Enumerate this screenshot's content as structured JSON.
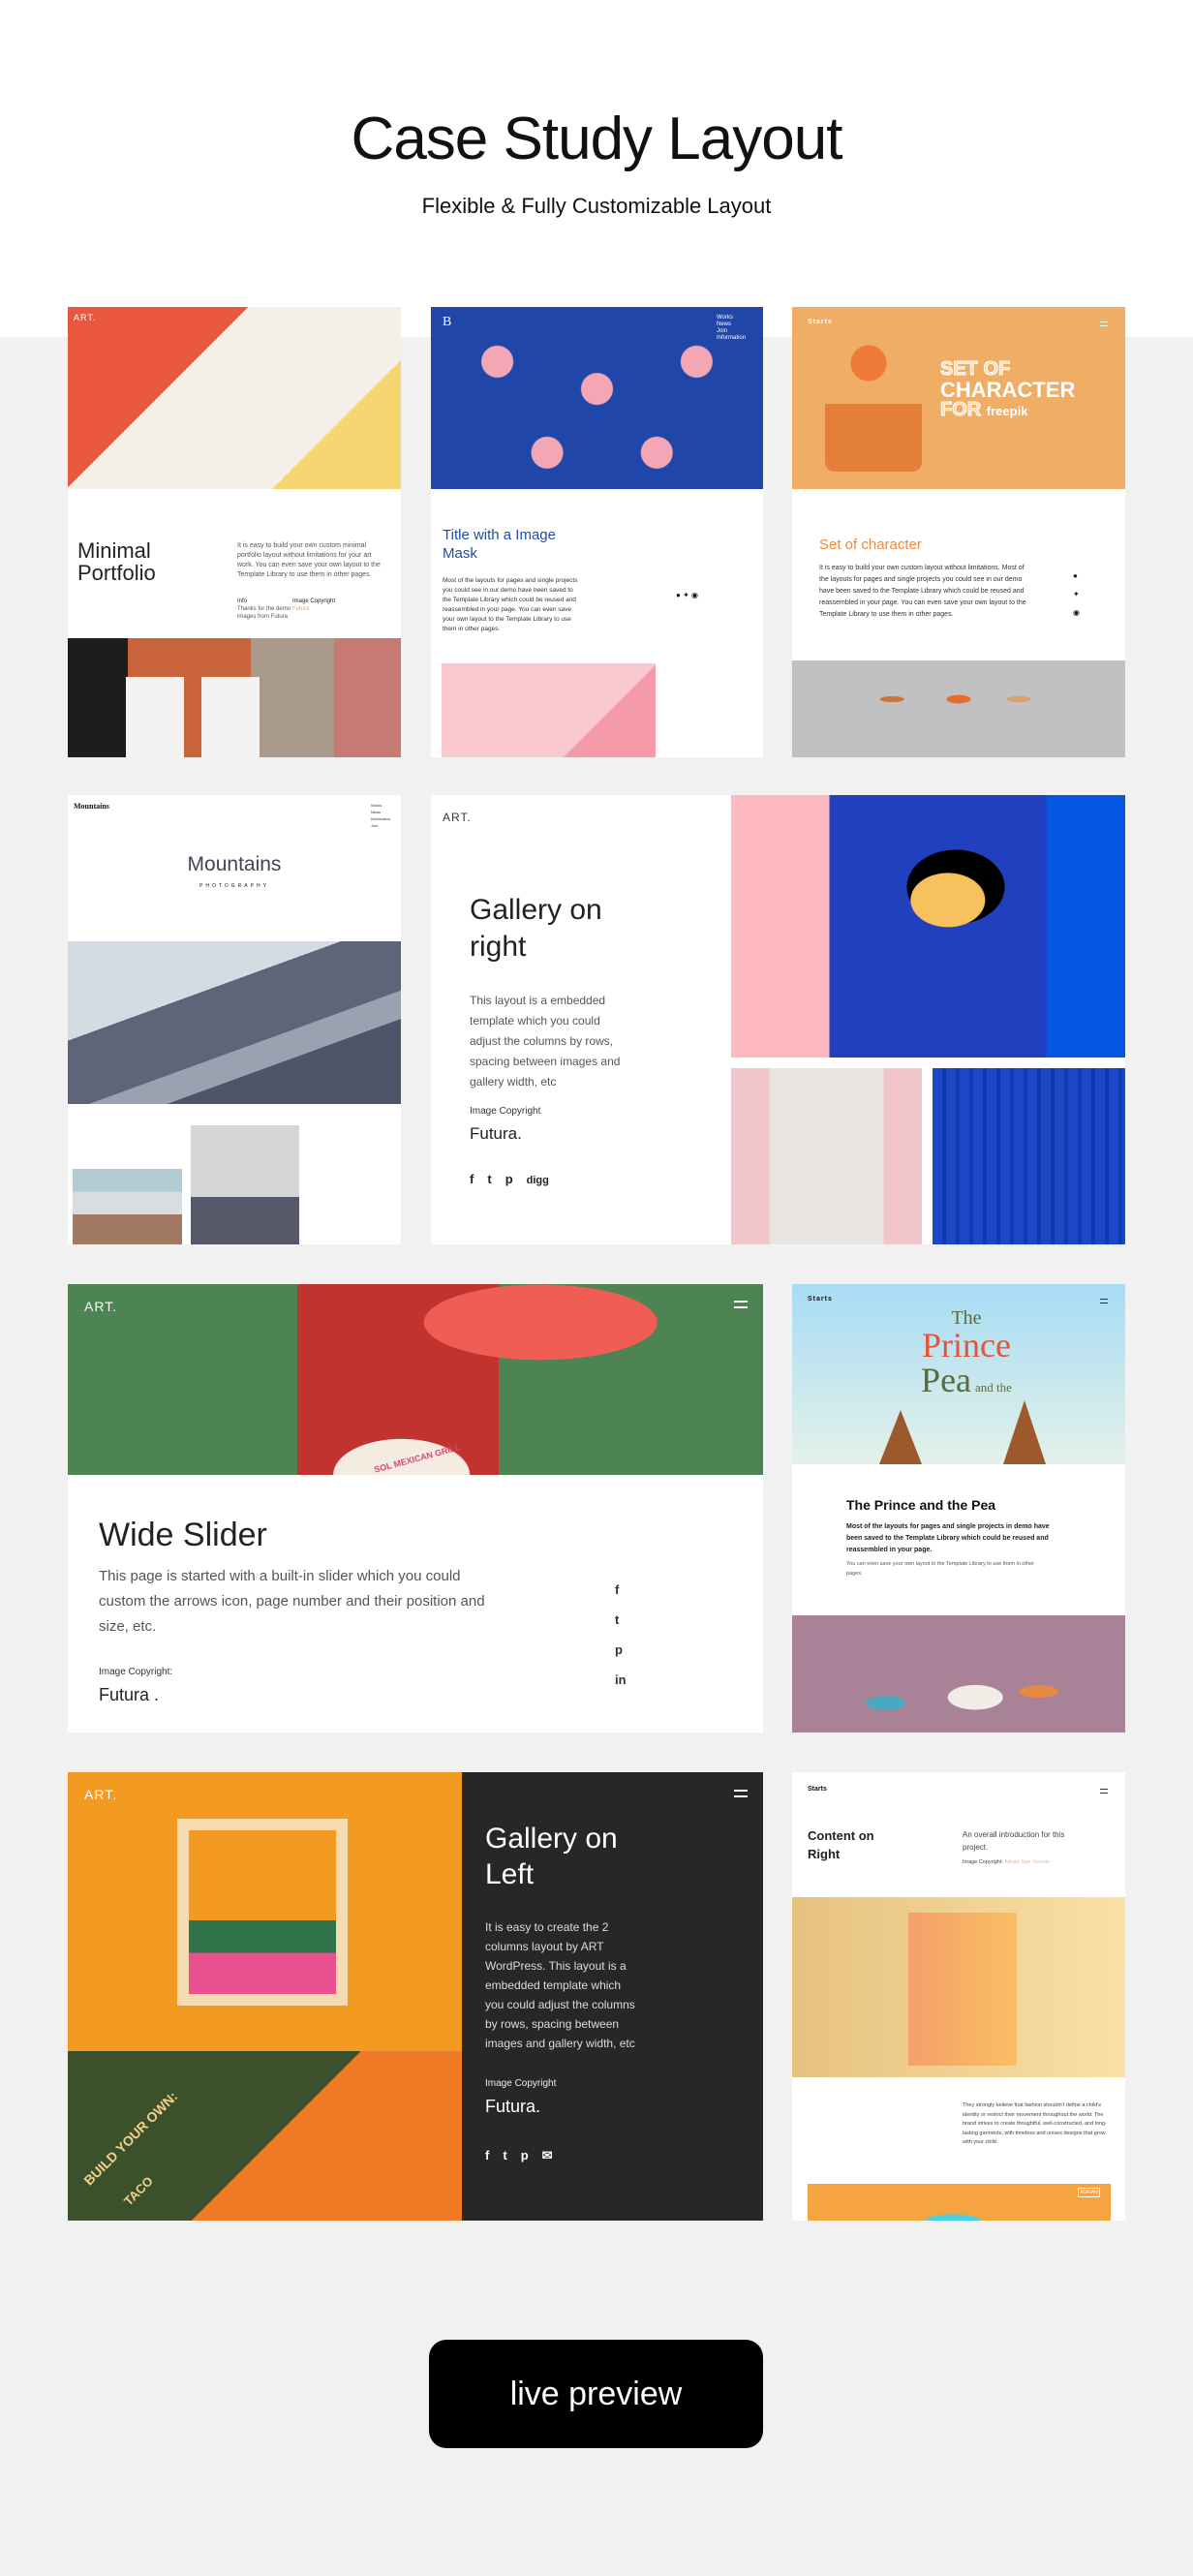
{
  "header": {
    "title": "Case Study Layout",
    "subtitle": "Flexible & Fully Customizable Layout"
  },
  "cards": {
    "minimal": {
      "logo": "ART.",
      "title_1": "Minimal",
      "title_2": "Portfolio",
      "body": "It is easy to build your own custom minimal portfolio layout without limitations for your art work. You can even save your own layout to the Template Library to use them in other pages.",
      "info_label": "Info",
      "info_text": "Thanks for the demo images from Futura",
      "copyright_label": "Image Copyright",
      "copyright_value": "Futura"
    },
    "mask": {
      "logo": "B",
      "nav": [
        "Works",
        "News",
        "Join",
        "Information"
      ],
      "title": "Title with a Image Mask",
      "body": "Most of the layouts for pages and single projects you could see in our demo have been saved to the Template Library which could be reused and reassembled in your page. You can even save your own layout to the Template Library to use them in other pages."
    },
    "character": {
      "logo": "Starts",
      "hero_1": "SET OF",
      "hero_2": "CHARACTER",
      "hero_3": "FOR",
      "hero_brand": "freepik",
      "title": "Set of character",
      "body": "It is easy to build your own custom layout without limitations. Most of the layouts for pages and single projects you could see in our demo have been saved to the Template Library which could be reused and reassembled in your page. You can even save your own layout to the Template Library to use them in other pages."
    },
    "mountains": {
      "logo": "Mountains",
      "nav": [
        "Works",
        "News",
        "Information",
        "Join"
      ],
      "title": "Mountains",
      "subtitle": "PHOTOGRAPHY"
    },
    "gallery_right": {
      "logo": "ART.",
      "title_1": "Gallery on",
      "title_2": "right",
      "body": "This layout is a embedded template which you could adjust the columns by rows, spacing between images and gallery width, etc",
      "copyright_label": "Image Copyright",
      "copyright_value": "Futura.",
      "digg": "digg"
    },
    "wide_slider": {
      "logo": "ART.",
      "label": "SOL MEXICAN GRILL",
      "title": "Wide Slider",
      "body": "This page is started with a built-in slider which you could custom the arrows icon, page number and their position and size, etc.",
      "copyright_label": "Image Copyright:",
      "copyright_value": "Futura ."
    },
    "prince": {
      "logo": "Starts",
      "hero_1": "The",
      "hero_2": "Prince",
      "hero_3": "and the",
      "hero_4": "Pea",
      "title": "The Prince and the Pea",
      "body_bold": "Most of the layouts for pages and single projects in demo have been saved to the Template Library which could be reused and reassembled in your page.",
      "body": "You can even save your own layout to the Template Library to use them in other pages."
    },
    "gallery_left": {
      "logo": "ART.",
      "title_1": "Gallery on",
      "title_2": "Left",
      "body": "It is easy to create the 2 columns layout by ART WordPress. This layout is a embedded template which you could adjust the columns by rows, spacing between images and gallery width, etc",
      "copyright_label": "Image Copyright",
      "copyright_value": "Futura.",
      "poster_text": "BUILD YOUR OWN:",
      "poster_text_2": "TACO"
    },
    "content_right": {
      "logo": "Starts",
      "title_1": "Content on",
      "title_2": "Right",
      "intro": "An overall introduction for this project.",
      "copyright_label": "Image Copyright:",
      "copyright_value": "Adrián San Vicente",
      "body": "They strongly believe that fashion shouldn't define a child's identity or restrict their movement throughout the world. The brand strives to create thoughtful, well-constructed, and long-lasting garments, with timeless and unisex designs that grow with your child.",
      "badge": "ADRIÁN"
    }
  },
  "cta": {
    "label": "live preview"
  },
  "colors": {
    "accent_orange": "#f0ad66",
    "dark_panel": "#272727",
    "button": "#000000"
  }
}
